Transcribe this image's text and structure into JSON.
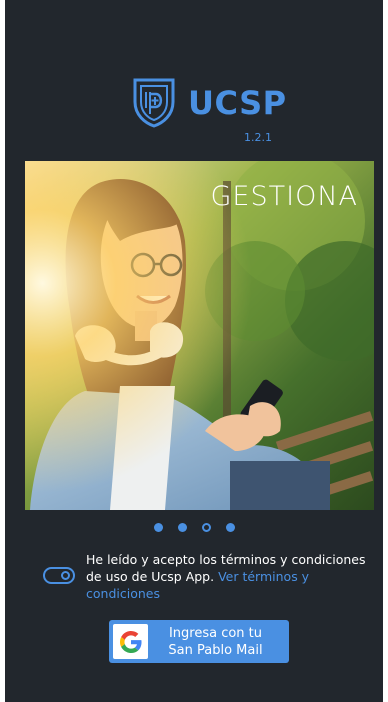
{
  "app": {
    "brand_name": "UCSP",
    "version": "1.2.1",
    "accent_color": "#4a90e2",
    "background_color": "#22272d"
  },
  "carousel": {
    "slide_caption": "GESTIONA",
    "slide_image": "young-woman-with-headphones-using-phone-outdoors",
    "total_slides": 4,
    "active_slide": 3
  },
  "terms": {
    "toggle_on": true,
    "text": "He leído y acepto los términos y condiciones de uso de Ucsp App.",
    "link_text": "Ver términos y condiciones"
  },
  "login_button": {
    "icon": "google-g-icon",
    "line1": "Ingresa con tu",
    "line2": "San Pablo Mail"
  }
}
